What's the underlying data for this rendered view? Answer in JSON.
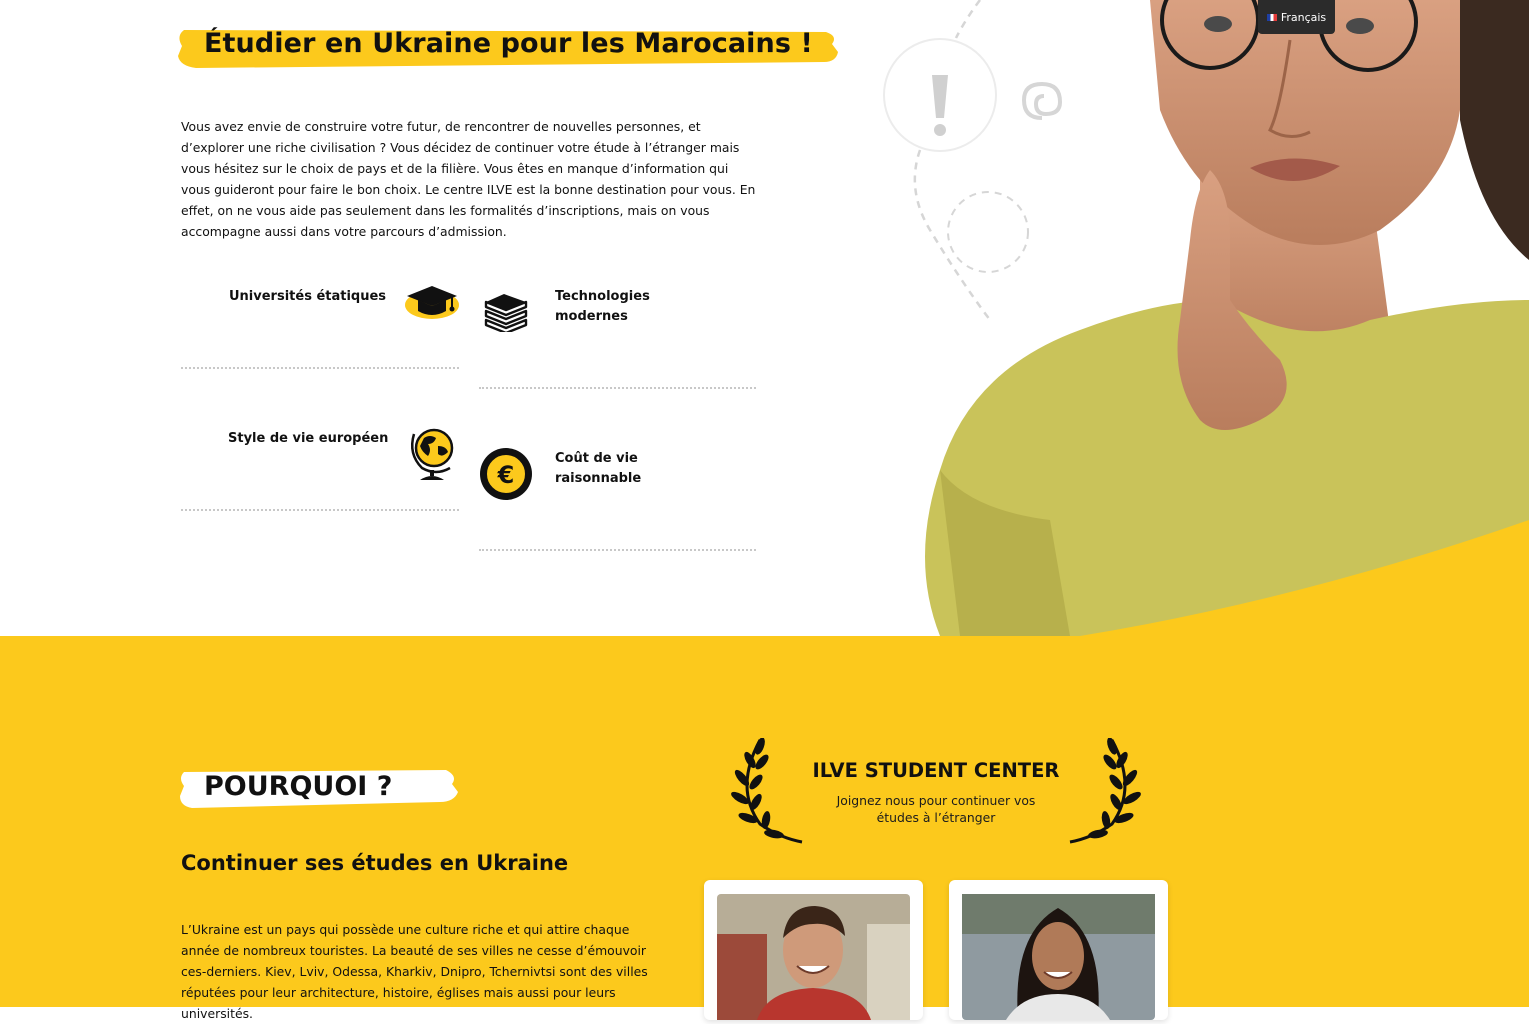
{
  "header": {
    "title": "Étudier en Ukraine pour les Marocains !",
    "intro": "Vous avez envie de construire votre futur, de rencontrer de nouvelles personnes, et d’explorer une riche civilisation ? Vous décidez de continuer votre étude à l’étranger mais vous hésitez sur le choix de pays et de la filière. Vous êtes en manque d’information qui vous guideront pour faire le bon choix. Le centre ILVE est la bonne destination pour vous. En effet, on ne vous aide pas seulement dans les formalités d’inscriptions, mais on vous accompagne aussi dans votre parcours d’admission."
  },
  "language": {
    "label": "Français"
  },
  "features": {
    "universities": {
      "label": "Universités étatiques",
      "icon": "graduation-cap-icon"
    },
    "technologies": {
      "label": "Technologies modernes",
      "icon": "books-icon"
    },
    "lifestyle": {
      "label": "Style de vie européen",
      "icon": "globe-icon"
    },
    "cost": {
      "label": "Coût de vie raisonnable",
      "icon": "euro-coin-icon"
    }
  },
  "why": {
    "title": "POURQUOI ?",
    "subtitle": "Continuer ses études en Ukraine",
    "text": "L’Ukraine est un pays qui possède une culture riche et qui attire chaque année de nombreux touristes. La beauté de ses villes ne cesse d’émouvoir ces-derniers. Kiev, Lviv, Odessa, Kharkiv, Dnipro, Tchernivtsi sont des villes réputées pour leur architecture, histoire, églises mais aussi pour leurs universités."
  },
  "center": {
    "title": "ILVE STUDENT CENTER",
    "subtitle": "Joignez nous pour continuer vos études à l’étranger"
  },
  "colors": {
    "accent": "#fcc91c",
    "text": "#111111",
    "shirt": "#c9c35a",
    "dark": "#2b2b2b"
  }
}
